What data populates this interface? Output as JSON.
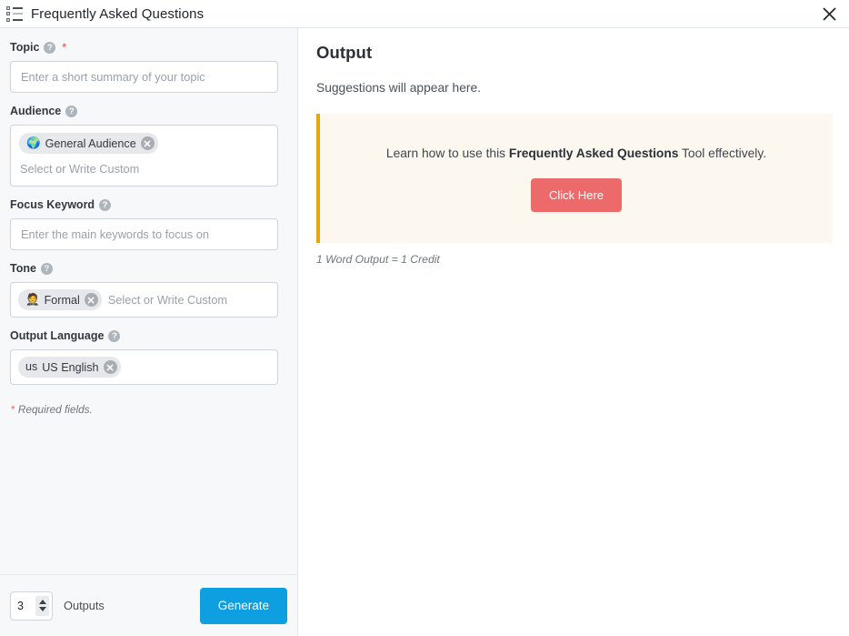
{
  "titlebar": {
    "icon": "list-icon",
    "title": "Frequently Asked Questions",
    "close_icon": "close-icon"
  },
  "form": {
    "topic": {
      "label": "Topic",
      "help_icon": "help-icon",
      "required_marker": "*",
      "placeholder": "Enter a short summary of your topic",
      "value": ""
    },
    "audience": {
      "label": "Audience",
      "help_icon": "help-icon",
      "placeholder": "Select or Write Custom",
      "tags": [
        {
          "emoji": "🌍",
          "label": "General Audience",
          "remove_icon": "remove-tag-icon"
        }
      ]
    },
    "focus_keyword": {
      "label": "Focus Keyword",
      "help_icon": "help-icon",
      "placeholder": "Enter the main keywords to focus on",
      "value": ""
    },
    "tone": {
      "label": "Tone",
      "help_icon": "help-icon",
      "placeholder": "Select or Write Custom",
      "tags": [
        {
          "emoji": "🤵",
          "label": "Formal",
          "remove_icon": "remove-tag-icon"
        }
      ]
    },
    "output_language": {
      "label": "Output Language",
      "help_icon": "help-icon",
      "placeholder": "",
      "tags": [
        {
          "emoji": "us",
          "label": "US English",
          "remove_icon": "remove-tag-icon"
        }
      ]
    },
    "required_note_star": "*",
    "required_note": " Required fields."
  },
  "footer": {
    "outputs_count": "3",
    "outputs_label": "Outputs",
    "stepper_up_icon": "stepper-up-arrow-icon",
    "stepper_down_icon": "stepper-down-arrow-icon",
    "generate_label": "Generate"
  },
  "output": {
    "title": "Output",
    "subtitle": "Suggestions will appear here.",
    "callout": {
      "text_before": "Learn how to use this ",
      "text_bold": "Frequently Asked Questions",
      "text_after": " Tool effectively.",
      "button_label": "Click Here"
    },
    "credit_note": "1 Word Output = 1 Credit"
  },
  "colors": {
    "accent_blue": "#0d9fe0",
    "callout_border": "#e8a50c",
    "callout_bg": "#fdf8ef",
    "click_here_red": "#ec6a6a",
    "required_red": "#f0656b",
    "panel_bg": "#f7f8fa"
  }
}
